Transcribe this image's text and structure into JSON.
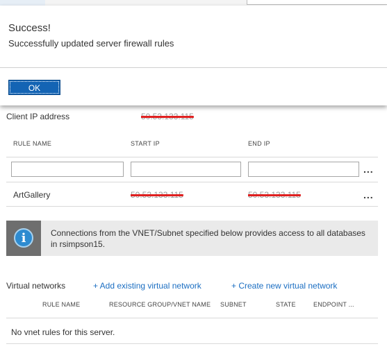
{
  "dialog": {
    "title": "Success!",
    "message": "Successfully updated server firewall rules",
    "ok_label": "OK"
  },
  "client_ip": {
    "label": "Client IP address",
    "value": "50.53.133.115"
  },
  "firewall_table": {
    "columns": [
      "RULE NAME",
      "START IP",
      "END IP"
    ],
    "new_row": {
      "rule_name": "",
      "start_ip": "",
      "end_ip": ""
    },
    "more_label": "...",
    "rows": [
      {
        "rule_name": "ArtGallery",
        "start_ip": "50.53.133.115",
        "end_ip": "50.53.133.115"
      }
    ]
  },
  "info_banner": {
    "icon": "info-icon",
    "glyph": "i",
    "text": "Connections from the VNET/Subnet specified below provides access to all databases in rsimpson15."
  },
  "vnet": {
    "label": "Virtual networks",
    "add_existing": "+ Add existing virtual network",
    "create_new": "+ Create new virtual network",
    "columns": [
      "RULE NAME",
      "RESOURCE GROUP/VNET NAME",
      "SUBNET",
      "STATE",
      "ENDPOINT ..."
    ],
    "empty_message": "No vnet rules for this server."
  },
  "colors": {
    "accent": "#1464b4",
    "link": "#1b6ec2",
    "redaction": "#e02020",
    "info_icon": "#2e8bd0"
  }
}
